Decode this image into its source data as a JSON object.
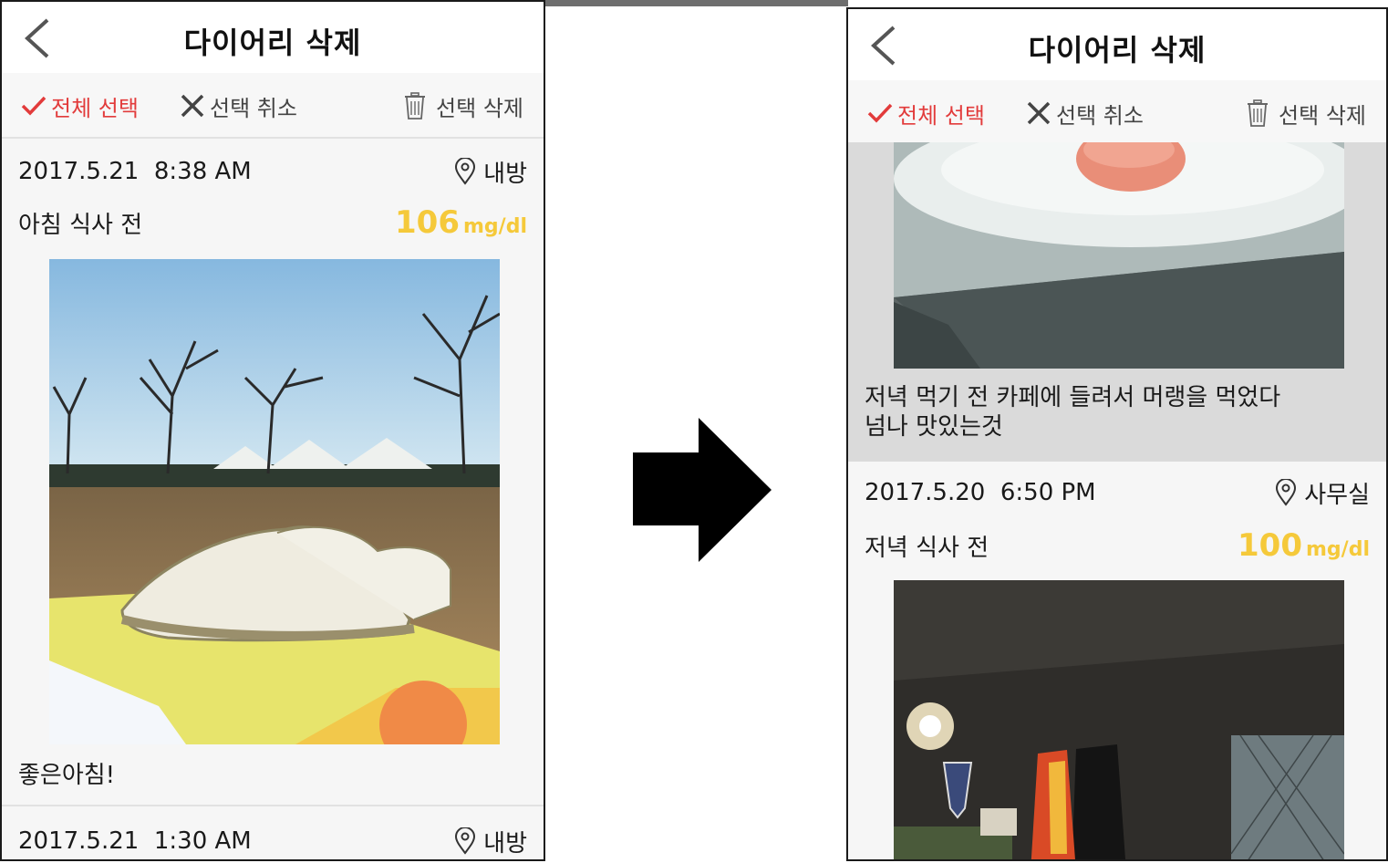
{
  "left_screen": {
    "title": "다이어리 삭제",
    "toolbar": {
      "select_all": "전체 선택",
      "cancel_selection": "선택 취소",
      "delete_selected": "선택 삭제"
    },
    "entries": [
      {
        "datetime": "2017.5.21  8:38 AM",
        "location": "내방",
        "meal": "아침 식사 전",
        "glucose_value": "106",
        "glucose_unit": "mg/dl",
        "note": "좋은아침!"
      },
      {
        "datetime": "2017.5.21  1:30 AM",
        "location": "내방"
      }
    ]
  },
  "right_screen": {
    "title": "다이어리 삭제",
    "toolbar": {
      "select_all": "전체 선택",
      "cancel_selection": "선택 취소",
      "delete_selected": "선택 삭제"
    },
    "entries": [
      {
        "note_line1": "저녁 먹기 전 카페에 들려서 머랭을 먹었다",
        "note_line2": "넘나 맛있는것"
      },
      {
        "datetime": "2017.5.20  6:50 PM",
        "location": "사무실",
        "meal": "저녁 식사 전",
        "glucose_value": "100",
        "glucose_unit": "mg/dl"
      }
    ]
  },
  "colors": {
    "accent_red": "#e23b3b",
    "glucose_yellow": "#f5c93a",
    "toolbar_bg": "#f7f7f7",
    "selected_bg": "#dadada"
  },
  "icons": [
    "back-chevron-icon",
    "check-icon",
    "close-x-icon",
    "trash-icon",
    "location-pin-icon",
    "right-arrow-icon"
  ]
}
